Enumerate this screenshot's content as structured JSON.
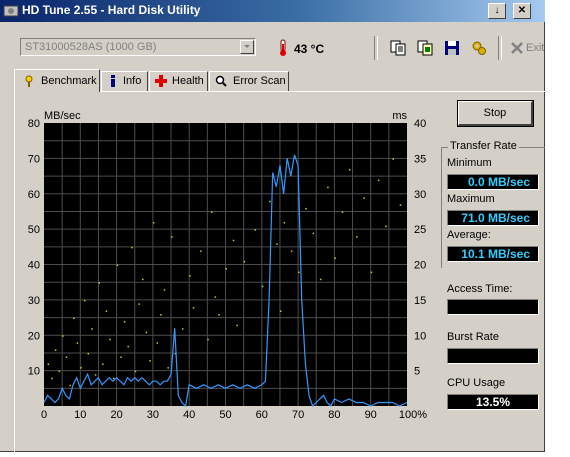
{
  "window": {
    "title": "HD Tune 2.55 - Hard Disk Utility",
    "controls": [
      "↓",
      "✕"
    ]
  },
  "toolbar": {
    "drive": "ST31000528AS (1000 GB)",
    "temperature": "43 °C",
    "icons": [
      "copy-text-icon",
      "copy-screenshot-icon",
      "save-icon",
      "options-icon"
    ],
    "exit_label": "Exit"
  },
  "tabs": [
    {
      "label": "Benchmark",
      "icon": "benchmark-icon",
      "active": true
    },
    {
      "label": "Info",
      "icon": "info-icon",
      "active": false
    },
    {
      "label": "Health",
      "icon": "health-icon",
      "active": false
    },
    {
      "label": "Error Scan",
      "icon": "error-scan-icon",
      "active": false
    }
  ],
  "side": {
    "stop_label": "Stop",
    "transfer_rate_label": "Transfer Rate",
    "minimum_label": "Minimum",
    "minimum_value": "0.0 MB/sec",
    "maximum_label": "Maximum",
    "maximum_value": "71.0 MB/sec",
    "average_label": "Average:",
    "average_value": "10.1 MB/sec",
    "access_time_label": "Access Time:",
    "access_time_value": "",
    "burst_rate_label": "Burst Rate",
    "burst_rate_value": "",
    "cpu_usage_label": "CPU Usage",
    "cpu_usage_value": "13.5%"
  },
  "colors": {
    "plot_bg": "#000000",
    "grid": "#4d4d4d",
    "transfer_line": "#3399ff",
    "access_points": "#c8c832"
  },
  "chart_data": {
    "type": "line",
    "xlabel": "",
    "ylabel": "MB/sec",
    "y2label": "ms",
    "xlim": [
      0,
      100
    ],
    "ylim": [
      0,
      80
    ],
    "y2lim": [
      0,
      40
    ],
    "x_ticks": [
      "0",
      "10",
      "20",
      "30",
      "40",
      "50",
      "60",
      "70",
      "80",
      "90",
      "100%"
    ],
    "y_ticks": [
      "10",
      "20",
      "30",
      "40",
      "50",
      "60",
      "70",
      "80"
    ],
    "y2_ticks": [
      "5",
      "10",
      "15",
      "20",
      "25",
      "30",
      "35",
      "40"
    ],
    "grid": true,
    "series": [
      {
        "x": [
          0,
          1,
          2,
          3,
          4,
          5,
          6,
          7,
          8,
          9,
          10,
          11,
          12,
          13,
          14,
          15,
          16,
          17,
          18,
          19,
          20,
          21,
          22,
          23,
          24,
          25,
          26,
          27,
          28,
          29,
          30,
          31,
          32,
          33,
          34,
          35,
          36,
          37,
          38,
          39,
          40,
          42,
          44,
          46,
          48,
          50,
          52,
          54,
          56,
          58,
          60,
          61,
          62,
          63,
          64,
          65,
          66,
          67,
          68,
          69,
          70,
          71,
          72,
          73,
          74,
          75,
          76,
          77,
          78,
          79,
          80,
          82,
          84,
          86,
          88,
          90,
          92,
          94,
          96,
          98,
          100
        ],
        "values": [
          1,
          3,
          2,
          1,
          2,
          5,
          3,
          2,
          6,
          8,
          5,
          7,
          9,
          6,
          7,
          8,
          6,
          7,
          8,
          7,
          8,
          7,
          6,
          8,
          7,
          8,
          7,
          8,
          7,
          6,
          7,
          7,
          6,
          7,
          7,
          9,
          22,
          3,
          1,
          0,
          6,
          5,
          6,
          5,
          6,
          5,
          6,
          5,
          6,
          5,
          6,
          7,
          30,
          66,
          62,
          68,
          60,
          70,
          65,
          71,
          68,
          30,
          12,
          3,
          0,
          1,
          2,
          3,
          1,
          0,
          2,
          1,
          2,
          1,
          1,
          0,
          1,
          1,
          1,
          0,
          1
        ]
      },
      {
        "x": [
          1,
          2,
          3,
          4,
          5,
          6,
          7,
          8,
          9,
          10,
          11,
          12,
          13,
          14,
          15,
          16,
          17,
          18,
          19,
          20,
          21,
          22,
          23,
          24,
          25,
          26,
          27,
          28,
          29,
          30,
          31,
          32,
          33,
          34,
          35,
          36,
          38,
          40,
          41,
          43,
          45,
          46,
          47,
          48,
          50,
          52,
          53,
          55,
          58,
          60,
          62,
          64,
          65,
          66,
          68,
          70,
          72,
          74,
          76,
          78,
          80,
          82,
          84,
          86,
          88,
          90,
          92,
          94,
          96,
          98
        ],
        "values": [
          12,
          8,
          16,
          10,
          20,
          14,
          6,
          25,
          18,
          11,
          30,
          15,
          22,
          9,
          35,
          12,
          27,
          19,
          8,
          40,
          14,
          24,
          17,
          45,
          10,
          29,
          36,
          21,
          13,
          52,
          18,
          26,
          33,
          11,
          48,
          15,
          22,
          37,
          28,
          44,
          19,
          55,
          31,
          26,
          39,
          47,
          23,
          41,
          50,
          34,
          58,
          46,
          27,
          52,
          44,
          38,
          56,
          49,
          36,
          62,
          42,
          55,
          67,
          48,
          59,
          38,
          64,
          51,
          70,
          57
        ]
      }
    ]
  }
}
